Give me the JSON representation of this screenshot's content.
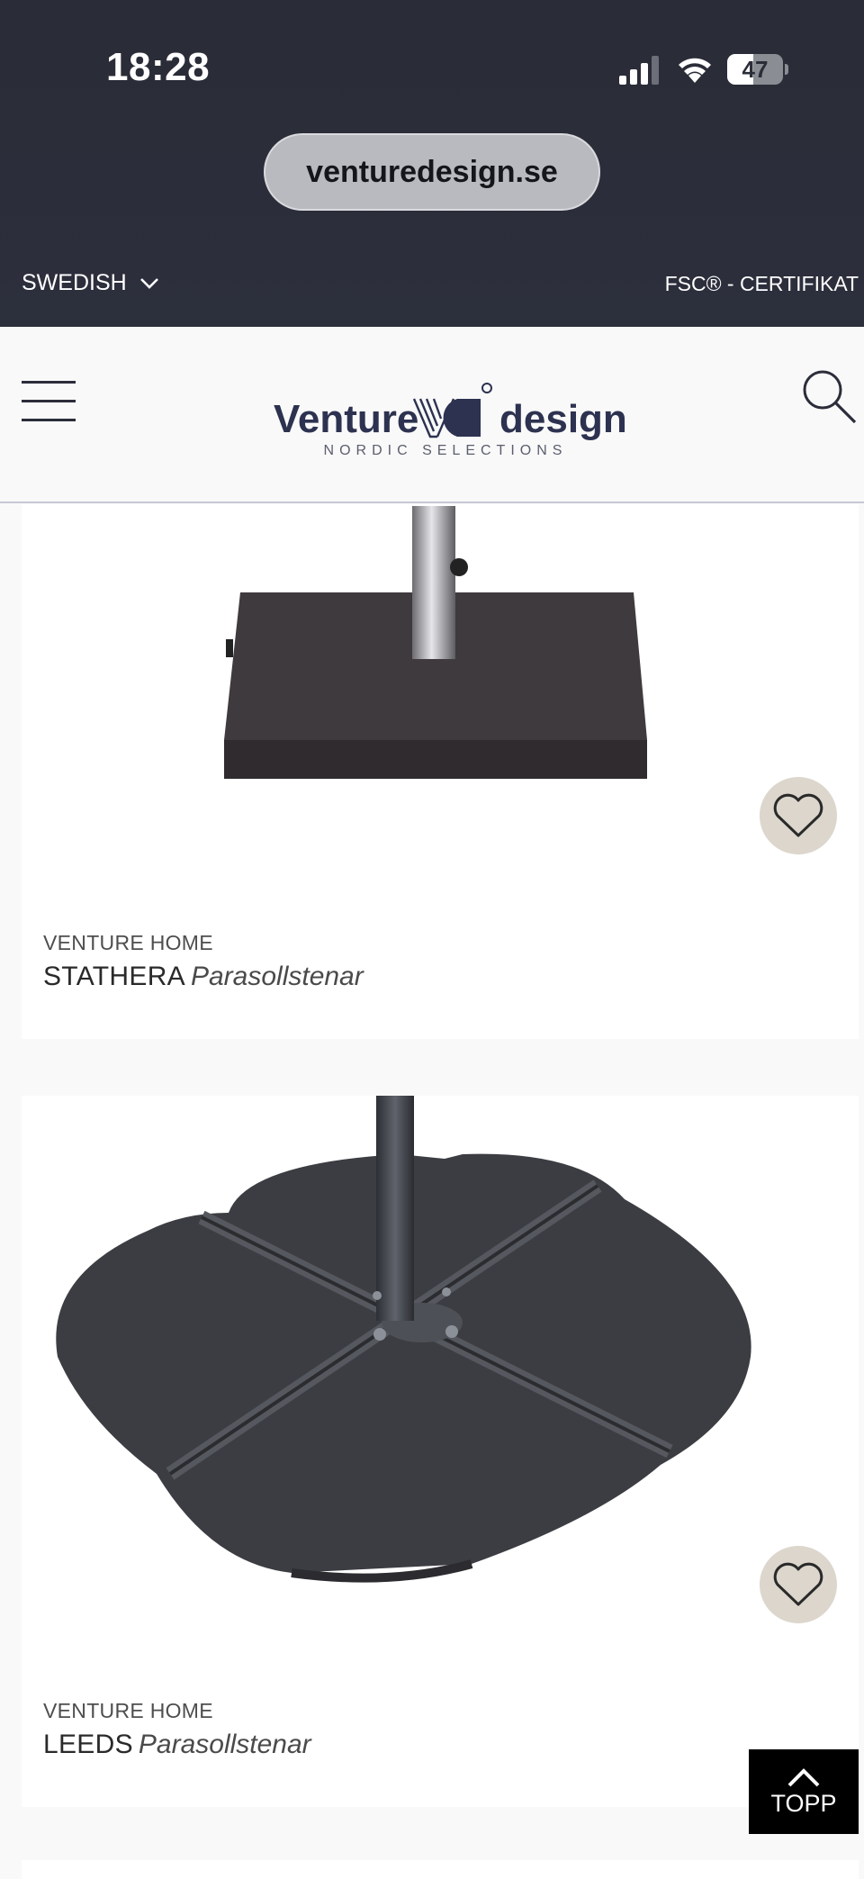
{
  "status_bar": {
    "time": "18:28",
    "battery_percent": "47"
  },
  "browser": {
    "url": "venturedesign.se"
  },
  "topbar": {
    "language": "SWEDISH",
    "certificate_link": "FSC® - CERTIFIKAT"
  },
  "header": {
    "logo_left": "Venture",
    "logo_right": "design",
    "logo_tagline": "NORDIC SELECTIONS"
  },
  "products": [
    {
      "brand": "VENTURE HOME",
      "name": "STATHERA",
      "type": "Parasollstenar"
    },
    {
      "brand": "VENTURE HOME",
      "name": "LEEDS",
      "type": "Parasollstenar"
    }
  ],
  "back_to_top": {
    "label": "TOPP"
  },
  "colors": {
    "header_bg": "#2a2c37",
    "logo": "#2d3250",
    "favorite_bg": "#dcd6cc"
  },
  "icons": [
    "chevron-down-icon",
    "hamburger-menu-icon",
    "search-icon",
    "heart-icon",
    "chevron-up-icon"
  ]
}
